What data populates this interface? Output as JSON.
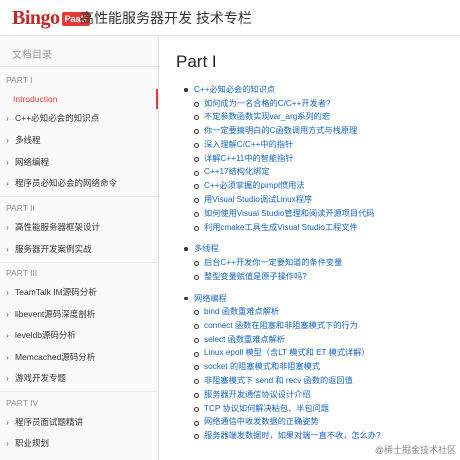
{
  "header": {
    "logo_text": "Bingo",
    "logo_badge": "PaaS",
    "site_title": "高性能服务器开发 技术专栏"
  },
  "sidebar": {
    "title": "文档目录",
    "sections": [
      {
        "label": "PART I",
        "items": [
          {
            "label": "Introduction",
            "active": true,
            "expandable": false
          },
          {
            "label": "C++必知必会的知识点",
            "expandable": true
          },
          {
            "label": "多线程",
            "expandable": true
          },
          {
            "label": "网络编程",
            "expandable": true
          },
          {
            "label": "程序员必知必会的网络命令",
            "expandable": true
          }
        ]
      },
      {
        "label": "PART II",
        "items": [
          {
            "label": "高性能服务器框架设计",
            "expandable": true
          },
          {
            "label": "服务器开发案例实战",
            "expandable": true
          }
        ]
      },
      {
        "label": "PART III",
        "items": [
          {
            "label": "TeamTalk IM源码分析",
            "expandable": true
          },
          {
            "label": "libevent源码深度剖析",
            "expandable": true
          },
          {
            "label": "leveldb源码分析",
            "expandable": true
          },
          {
            "label": "Memcached源码分析",
            "expandable": true
          },
          {
            "label": "游戏开发专题",
            "expandable": true
          }
        ]
      },
      {
        "label": "PART IV",
        "items": [
          {
            "label": "程序员面试题精讲",
            "expandable": true
          },
          {
            "label": "职业规划",
            "expandable": true
          }
        ]
      }
    ]
  },
  "main": {
    "title": "Part I",
    "toc": [
      {
        "label": "C++必知必会的知识点",
        "children": [
          "如何成为一名合格的C/C++开发者?",
          "不定参数函数实现var_arg系列的宏",
          "你一定要搞明白的C函数调用方式与栈原理",
          "深入理解C/C++中的指针",
          "详解C++11中的智能指针",
          "C++17结构化绑定",
          "C++必须掌握的pimpl惯用法",
          "用Visual Studio调试Linux程序",
          "如何使用Visual Studio管理和阅读开源项目代码",
          "利用cmake工具生成Visual Studio工程文件"
        ]
      },
      {
        "label": "多线程",
        "children": [
          "后台C++开发你一定要知道的条件变量",
          "整型变量赋值是原子操作吗?"
        ]
      },
      {
        "label": "网络编程",
        "children": [
          "bind 函数重难点解析",
          "connect 函数在阻塞和非阻塞模式下的行为",
          "select 函数重难点解析",
          "Linux epoll 模型（含LT 模式和 ET 模式详解）",
          "socket 的阻塞模式和非阻塞模式",
          "非阻塞模式下 send 和 recv 函数的返回值",
          "服务器开发通信协议设计介绍",
          "TCP 协议如何解决粘包、半包问题",
          "网络通信中收发数据的正确姿势",
          "服务器端发数据时，如果对端一直不收，怎么办?"
        ]
      }
    ]
  },
  "watermark": "@稀土掘金技术社区"
}
